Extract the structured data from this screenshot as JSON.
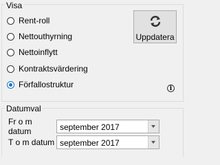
{
  "visa": {
    "title": "Visa",
    "options": [
      {
        "label": "Rent-roll",
        "checked": false
      },
      {
        "label": "Nettouthyrning",
        "checked": false
      },
      {
        "label": "Nettoinflytt",
        "checked": false
      },
      {
        "label": "Kontraktsvärdering",
        "checked": false
      },
      {
        "label": "Förfallostruktur",
        "checked": true
      }
    ],
    "update_label": "Uppdatera"
  },
  "datumval": {
    "title": "Datumval",
    "from_label": "Fr o m datum",
    "from_value": "september 2017",
    "to_label": "T o m datum",
    "to_value": "september 2017"
  },
  "colors": {
    "accent": "#1a73c7"
  },
  "icons": {
    "update": "refresh-icon",
    "info": "info-icon"
  }
}
